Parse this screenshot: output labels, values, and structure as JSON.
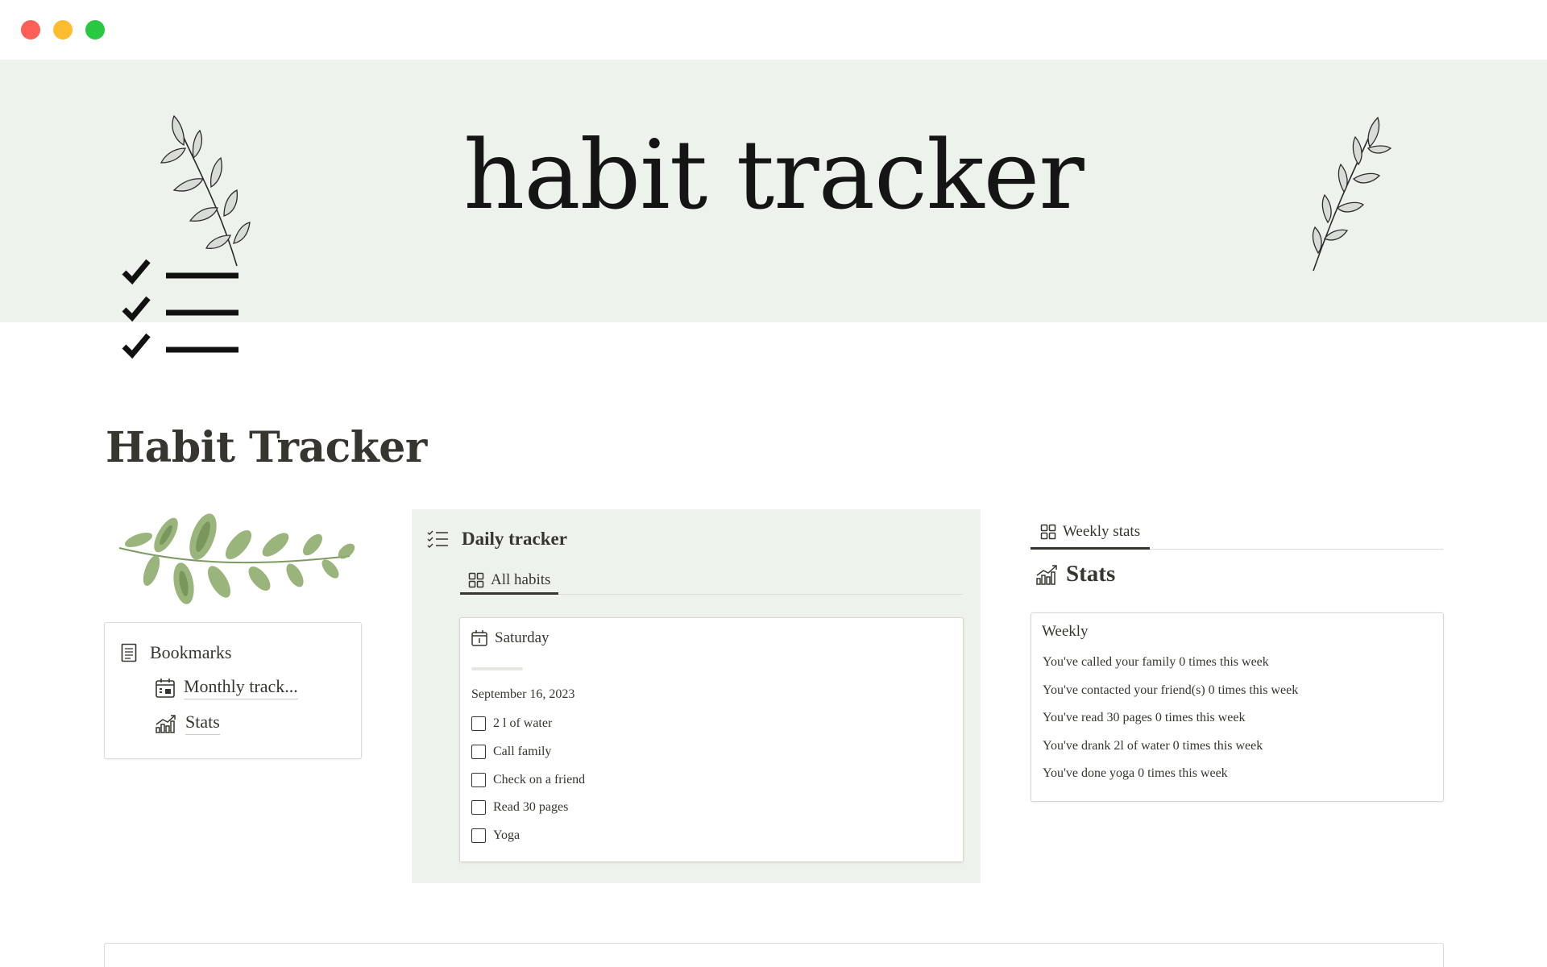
{
  "cover": {
    "title": "habit tracker"
  },
  "page": {
    "title": "Habit Tracker"
  },
  "bookmarks": {
    "title": "Bookmarks",
    "links": [
      {
        "label": "Monthly track...",
        "icon": "calendar-icon"
      },
      {
        "label": "Stats",
        "icon": "growth-chart-icon"
      }
    ]
  },
  "daily_tracker": {
    "title": "Daily tracker",
    "view_tab": "All habits",
    "card": {
      "day": "Saturday",
      "date": "September 16, 2023",
      "habits": [
        "2 l of water",
        "Call family",
        "Check on a friend",
        "Read 30 pages",
        "Yoga"
      ]
    }
  },
  "weekly_stats": {
    "view_tab": "Weekly stats",
    "heading": "Stats",
    "card": {
      "title": "Weekly",
      "lines": [
        "You've called your family 0 times this week",
        "You've contacted your friend(s) 0 times this week",
        "You've read 30 pages 0 times this week",
        "You've drank 2l of water 0 times this week",
        "You've done yoga 0 times this week"
      ]
    }
  },
  "colors": {
    "cover_bg": "#eef2ec",
    "text": "#37352f",
    "traffic_red": "#fe5f57",
    "traffic_yellow": "#febc2e",
    "traffic_green": "#28c840"
  }
}
